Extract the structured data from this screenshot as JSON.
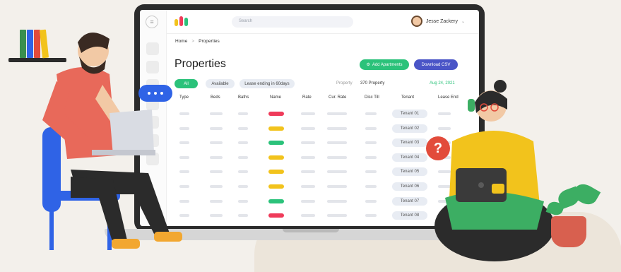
{
  "header": {
    "search_placeholder": "Search",
    "user_name": "Jesse Zackery"
  },
  "breadcrumb": {
    "home": "Home",
    "separator": ">",
    "current": "Properties"
  },
  "page": {
    "title": "Properties",
    "add_button": "Add Apartments",
    "csv_button": "Download CSV"
  },
  "filters": {
    "all": "All",
    "available": "Available",
    "lease": "Lease ending in 60days"
  },
  "meta": {
    "label": "Property",
    "count": "370 Property",
    "date": "Aug 24, 2021"
  },
  "table": {
    "headers": [
      "Type",
      "Beds",
      "Baths",
      "Name",
      "Rate",
      "Cur. Rate",
      "Disc Till",
      "Tenant",
      "Lease End"
    ],
    "tenants": [
      "Tenant 01",
      "Tenant 02",
      "Tenant 03",
      "Tenant 04",
      "Tenant 05",
      "Tenant 06",
      "Tenant 07",
      "Tenant 08"
    ],
    "status_colors": [
      "#ef3b5a",
      "#f2c31c",
      "#2bc27a",
      "#f2c31c",
      "#f2c31c",
      "#f2c31c",
      "#2bc27a",
      "#ef3b5a"
    ]
  },
  "colors": {
    "accent_green": "#2bc27a",
    "accent_blue": "#4a55c7",
    "chat_blue": "#2f63e6",
    "help_red": "#e24b3b"
  }
}
